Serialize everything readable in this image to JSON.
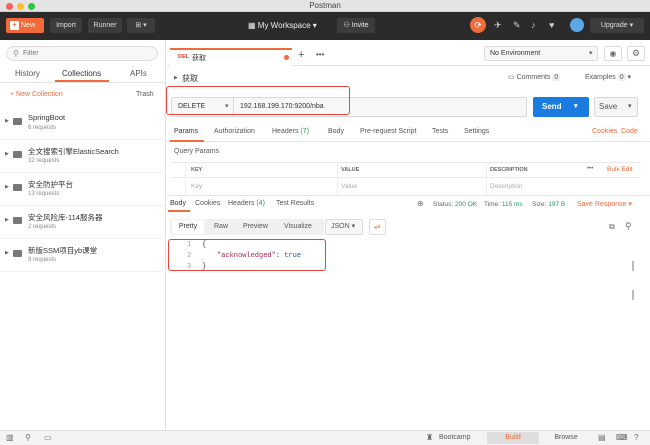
{
  "window": {
    "title": "Postman"
  },
  "toolbar": {
    "new": "New",
    "import": "Import",
    "runner": "Runner",
    "workspace": "My Workspace",
    "invite": "Invite",
    "upgrade": "Upgrade"
  },
  "sidebar": {
    "filter_placeholder": "Filter",
    "tabs": [
      "History",
      "Collections",
      "APIs"
    ],
    "new_collection": "+ New Collection",
    "trash": "Trash",
    "collections": [
      {
        "name": "SpringBoot",
        "count": "6 requests"
      },
      {
        "name": "全文搜索引擎ElasticSearch",
        "count": "32 requests"
      },
      {
        "name": "安全防护平台",
        "count": "13 requests"
      },
      {
        "name": "安全风险库-114服务器",
        "count": "2 requests"
      },
      {
        "name": "新版SSM项目yb课堂",
        "count": "9 requests"
      }
    ]
  },
  "request_tab": {
    "method_badge": "DEL",
    "name": "获取"
  },
  "environment": {
    "selected": "No Environment"
  },
  "request": {
    "title": "获取",
    "comments": "Comments",
    "comments_count": "0",
    "examples": "Examples",
    "examples_count": "0",
    "method": "DELETE",
    "url": "192.168.199.170:9200/nba",
    "send": "Send",
    "save": "Save",
    "tabs": [
      "Params",
      "Authorization",
      "Headers",
      "Body",
      "Pre-request Script",
      "Tests",
      "Settings"
    ],
    "headers_count": "(7)",
    "cookies": "Cookies",
    "code": "Code",
    "query_params": "Query Params",
    "columns": [
      "KEY",
      "VALUE",
      "DESCRIPTION"
    ],
    "more": "•••",
    "bulk_edit": "Bulk Edit",
    "key_placeholder": "Key",
    "value_placeholder": "Value",
    "desc_placeholder": "Description"
  },
  "response": {
    "tabs": [
      "Body",
      "Cookies",
      "Headers",
      "Test Results"
    ],
    "headers_count": "(4)",
    "status_label": "Status:",
    "status": "200 OK",
    "time_label": "Time:",
    "time": "115 ms",
    "size_label": "Size:",
    "size": "197 B",
    "save_response": "Save Response",
    "views": [
      "Pretty",
      "Raw",
      "Preview",
      "Visualize"
    ],
    "format": "JSON",
    "lines": [
      {
        "num": "1",
        "text": "{"
      },
      {
        "num": "2",
        "key": "\"acknowledged\"",
        "sep": ": ",
        "val": "true"
      },
      {
        "num": "3",
        "text": "}"
      }
    ]
  },
  "statusbar": {
    "bootcamp": "Bootcamp",
    "build": "Build",
    "browse": "Browse"
  }
}
